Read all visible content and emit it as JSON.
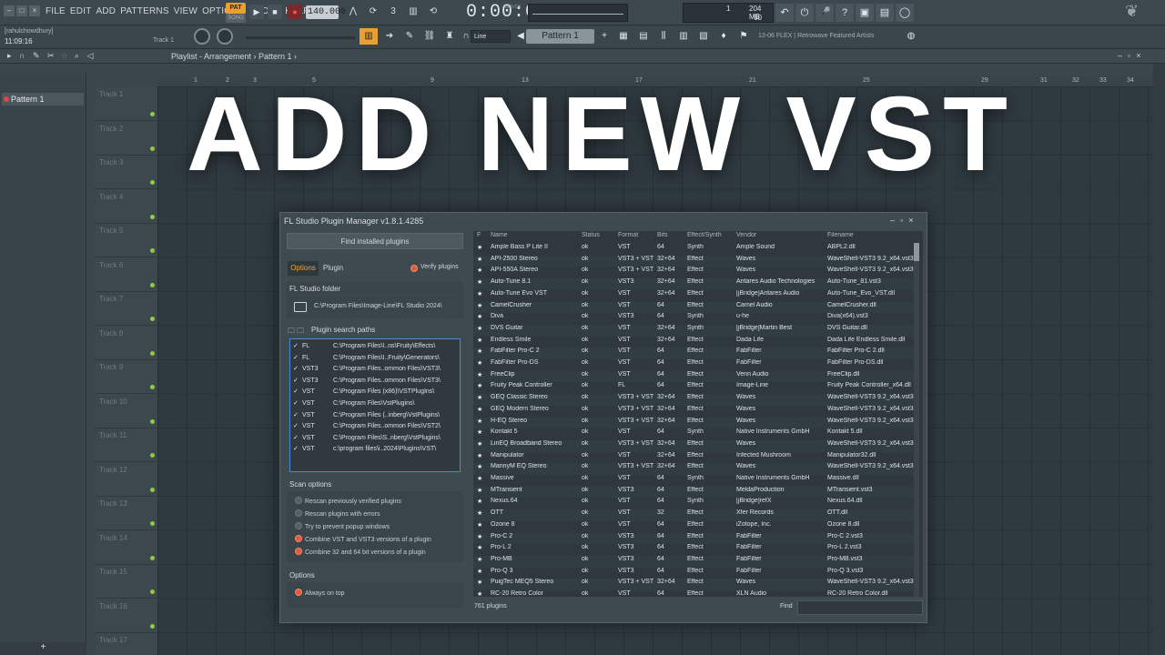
{
  "menu": [
    "FILE",
    "EDIT",
    "ADD",
    "PATTERNS",
    "VIEW",
    "OPTIONS",
    "TOOLS",
    "HELP"
  ],
  "transport": {
    "pat": "PAT",
    "song": "SONG",
    "tempo": "140.000",
    "time": "0:00:00",
    "time_unit": "M:S:CS"
  },
  "cpu": {
    "voices": "1",
    "ram": "204 MB",
    "poly": "60"
  },
  "hint": {
    "user": "[rahulchowdhury]",
    "clock": "11:09:16",
    "track": "Track 1"
  },
  "snap": "Line",
  "pattern": "Pattern 1",
  "news": "13-06  FLEX | Retrowave Featured Artists",
  "playlist": {
    "title": "Playlist - Arrangement › Pattern 1 ›",
    "pattern_item": "Pattern 1",
    "add": "+"
  },
  "tracks": [
    "Track 1",
    "Track 2",
    "Track 3",
    "Track 4",
    "Track 5",
    "Track 6",
    "Track 7",
    "Track 8",
    "Track 9",
    "Track 10",
    "Track 11",
    "Track 12",
    "Track 13",
    "Track 14",
    "Track 15",
    "Track 16",
    "Track 17"
  ],
  "ruler": [
    "1",
    "2",
    "3",
    "5",
    "9",
    "13",
    "17",
    "21",
    "25",
    "29",
    "31",
    "32",
    "33",
    "34"
  ],
  "headline": "ADD NEW VST",
  "pm": {
    "title": "FL Studio Plugin Manager v1.8.1.4285",
    "find_installed": "Find installed plugins",
    "tab_options": "Options",
    "tab_plugin": "Plugin",
    "verify": "Verify plugins",
    "fl_folder_h": "FL Studio folder",
    "fl_folder": "C:\\Program Files\\Image-Line\\FL Studio 2024\\",
    "search_paths_h": "Plugin search paths",
    "paths": [
      [
        "FL",
        "C:\\Program Files\\I..ns\\Fruity\\Effects\\"
      ],
      [
        "FL",
        "C:\\Program Files\\I..Fruity\\Generators\\"
      ],
      [
        "VST3",
        "C:\\Program Files..ommon Files\\VST3\\"
      ],
      [
        "VST3",
        "C:\\Program Files..ommon Files\\VST3\\"
      ],
      [
        "VST",
        "C:\\Program Files (x86)\\VSTPlugIns\\"
      ],
      [
        "VST",
        "C:\\Program Files\\VstPlugins\\"
      ],
      [
        "VST",
        "C:\\Program Files (..inberg\\VstPlugins\\"
      ],
      [
        "VST",
        "C:\\Program Files..ommon Files\\VST2\\"
      ],
      [
        "VST",
        "C:\\Program Files\\S..nberg\\VstPlugins\\"
      ],
      [
        "VST",
        "c:\\program files\\i..2024\\Plugins\\VST\\"
      ]
    ],
    "scan_h": "Scan options",
    "scan": [
      {
        "label": "Rescan previously verified plugins",
        "on": false
      },
      {
        "label": "Rescan plugins with errors",
        "on": false
      },
      {
        "label": "Try to prevent popup windows",
        "on": false
      },
      {
        "label": "Combine VST and VST3 versions of a plugin",
        "on": true
      },
      {
        "label": "Combine 32 and 64 bit versions of a plugin",
        "on": true
      }
    ],
    "options_h": "Options",
    "always_on_top": "Always on top",
    "columns": [
      "F",
      "Name",
      "Status",
      "Format",
      "Bits",
      "Effect/Synth",
      "Vendor",
      "Filename"
    ],
    "rows": [
      [
        "Ample Bass P Lite II",
        "ok",
        "VST",
        "64",
        "Synth",
        "Ample Sound",
        "ABPL2.dll"
      ],
      [
        "API-2500 Stereo",
        "ok",
        "VST3 + VST",
        "32+64",
        "Effect",
        "Waves",
        "WaveShell-VST3 9.2_x64.vst3"
      ],
      [
        "API-550A Stereo",
        "ok",
        "VST3 + VST",
        "32+64",
        "Effect",
        "Waves",
        "WaveShell-VST3 9.2_x64.vst3"
      ],
      [
        "Auto-Tune 8.1",
        "ok",
        "VST3",
        "32+64",
        "Effect",
        "Antares Audio Technologies",
        "Auto-Tune_81.vst3"
      ],
      [
        "Auto-Tune Evo VST",
        "ok",
        "VST",
        "32+64",
        "Effect",
        "[jBridge]Antares Audio",
        "Auto-Tune_Evo_VST.dll"
      ],
      [
        "CamelCrusher",
        "ok",
        "VST",
        "64",
        "Effect",
        "Camel Audio",
        "CamelCrusher.dll"
      ],
      [
        "Diva",
        "ok",
        "VST3",
        "64",
        "Synth",
        "u-he",
        "Diva(x64).vst3"
      ],
      [
        "DVS Guitar",
        "ok",
        "VST",
        "32+64",
        "Synth",
        "[jBridge]Martin Best",
        "DVS Guitar.dll"
      ],
      [
        "Endless Smile",
        "ok",
        "VST",
        "32+64",
        "Effect",
        "Dada Life",
        "Dada Life Endless Smile.dll"
      ],
      [
        "FabFilter Pro-C 2",
        "ok",
        "VST",
        "64",
        "Effect",
        "FabFilter",
        "FabFilter Pro-C 2.dll"
      ],
      [
        "FabFilter Pro-DS",
        "ok",
        "VST",
        "64",
        "Effect",
        "FabFilter",
        "FabFilter Pro-DS.dll"
      ],
      [
        "FreeClip",
        "ok",
        "VST",
        "64",
        "Effect",
        "Venn Audio",
        "FreeClip.dll"
      ],
      [
        "Fruity Peak Controller",
        "ok",
        "FL",
        "64",
        "Effect",
        "Image-Line",
        "Fruity Peak Controller_x64.dll"
      ],
      [
        "GEQ Classic Stereo",
        "ok",
        "VST3 + VST",
        "32+64",
        "Effect",
        "Waves",
        "WaveShell-VST3 9.2_x64.vst3"
      ],
      [
        "GEQ Modern Stereo",
        "ok",
        "VST3 + VST",
        "32+64",
        "Effect",
        "Waves",
        "WaveShell-VST3 9.2_x64.vst3"
      ],
      [
        "H-EQ Stereo",
        "ok",
        "VST3 + VST",
        "32+64",
        "Effect",
        "Waves",
        "WaveShell-VST3 9.2_x64.vst3"
      ],
      [
        "Kontakt 5",
        "ok",
        "VST",
        "64",
        "Synth",
        "Native Instruments GmbH",
        "Kontakt 5.dll"
      ],
      [
        "LinEQ Broadband Stereo",
        "ok",
        "VST3 + VST",
        "32+64",
        "Effect",
        "Waves",
        "WaveShell-VST3 9.2_x64.vst3"
      ],
      [
        "Manipulator",
        "ok",
        "VST",
        "32+64",
        "Effect",
        "Infected Mushroom",
        "Manipulator32.dll"
      ],
      [
        "MannyM EQ Stereo",
        "ok",
        "VST3 + VST",
        "32+64",
        "Effect",
        "Waves",
        "WaveShell-VST3 9.2_x64.vst3"
      ],
      [
        "Massive",
        "ok",
        "VST",
        "64",
        "Synth",
        "Native Instruments GmbH",
        "Massive.dll"
      ],
      [
        "MTransient",
        "ok",
        "VST3",
        "64",
        "Effect",
        "MeldaProduction",
        "MTransient.vst3"
      ],
      [
        "Nexus.64",
        "ok",
        "VST",
        "64",
        "Synth",
        "[jBridge]refX",
        "Nexus.64.dll"
      ],
      [
        "OTT",
        "ok",
        "VST",
        "32",
        "Effect",
        "Xfer Records",
        "OTT.dll"
      ],
      [
        "Ozone 8",
        "ok",
        "VST",
        "64",
        "Effect",
        "iZotope, Inc.",
        "Ozone 8.dll"
      ],
      [
        "Pro-C 2",
        "ok",
        "VST3",
        "64",
        "Effect",
        "FabFilter",
        "Pro-C 2.vst3"
      ],
      [
        "Pro-L 2",
        "ok",
        "VST3",
        "64",
        "Effect",
        "FabFilter",
        "Pro-L 2.vst3"
      ],
      [
        "Pro-MB",
        "ok",
        "VST3",
        "64",
        "Effect",
        "FabFilter",
        "Pro-MB.vst3"
      ],
      [
        "Pro-Q 3",
        "ok",
        "VST3",
        "64",
        "Effect",
        "FabFilter",
        "Pro-Q 3.vst3"
      ],
      [
        "PuigTec MEQ5 Stereo",
        "ok",
        "VST3 + VST",
        "32+64",
        "Effect",
        "Waves",
        "WaveShell-VST3 9.2_x64.vst3"
      ],
      [
        "RC-20 Retro Color",
        "ok",
        "VST",
        "64",
        "Effect",
        "XLN Audio",
        "RC-20 Retro Color.dll"
      ]
    ],
    "count": "761 plugins",
    "find": "Find"
  }
}
